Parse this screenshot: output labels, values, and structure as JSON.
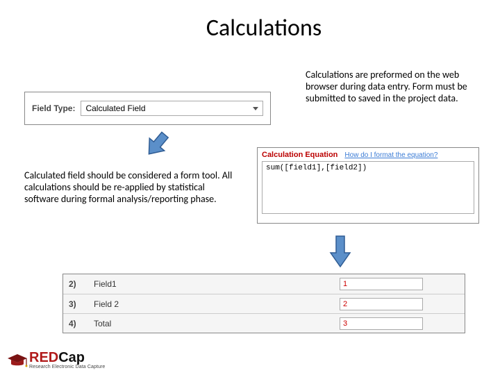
{
  "title": "Calculations",
  "fieldtype": {
    "label": "Field Type:",
    "selected": "Calculated Field"
  },
  "paragraphs": {
    "top_right": "Calculations are preformed on the web browser during data entry.  Form must be submitted to saved in the project data.",
    "left_mid": "Calculated field should be considered a form tool.  All calculations should be re-applied by statistical software during formal analysis/reporting phase."
  },
  "calc": {
    "label": "Calculation Equation",
    "hint": "How do I format the equation?",
    "value": "sum([field1],[field2])"
  },
  "fields": [
    {
      "num": "2)",
      "label": "Field1",
      "value": "1"
    },
    {
      "num": "3)",
      "label": "Field 2",
      "value": "2"
    },
    {
      "num": "4)",
      "label": "Total",
      "value": "3"
    }
  ],
  "logo": {
    "brand_red": "RED",
    "brand_black": "Cap",
    "subtitle": "Research Electronic Data Capture"
  },
  "colors": {
    "arrow_fill": "#5b8fc9",
    "arrow_stroke": "#2f5c93",
    "accent_red": "#b11a1a"
  }
}
